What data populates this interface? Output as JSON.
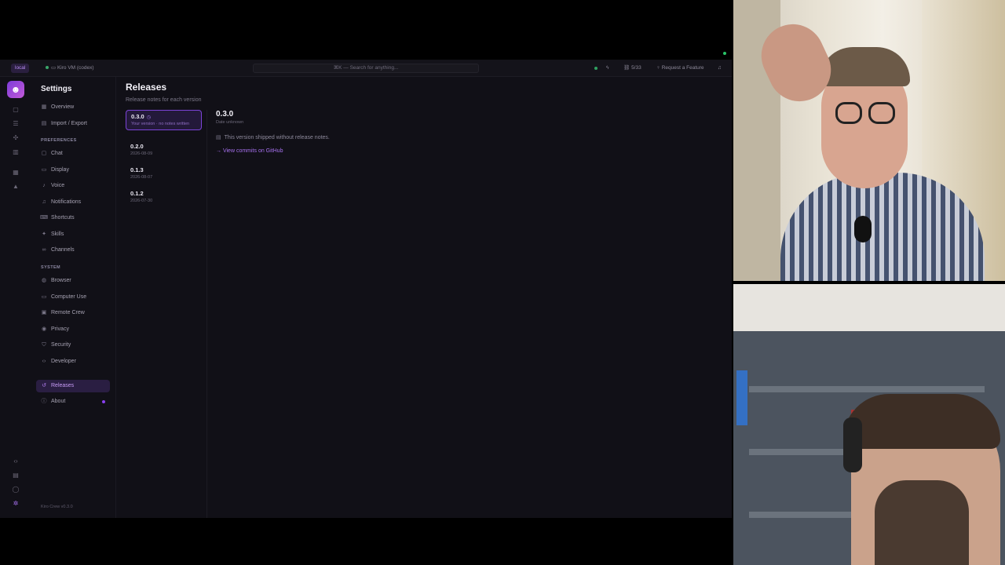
{
  "topbar": {
    "local_label": "local",
    "vm_label": "Kiro VM (codex)",
    "search_placeholder": "⌘K — Search for anything...",
    "count_label": "5/33",
    "feature_label": "Request a Feature"
  },
  "sidebar": {
    "title": "Settings",
    "top_items": [
      {
        "label": "Overview",
        "icon": "grid-icon"
      },
      {
        "label": "Import / Export",
        "icon": "import-icon"
      }
    ],
    "preferences_heading": "PREFERENCES",
    "preferences_items": [
      {
        "label": "Chat",
        "icon": "chat-icon"
      },
      {
        "label": "Display",
        "icon": "display-icon"
      },
      {
        "label": "Voice",
        "icon": "voice-icon"
      },
      {
        "label": "Notifications",
        "icon": "bell-icon"
      },
      {
        "label": "Shortcuts",
        "icon": "keyboard-icon"
      },
      {
        "label": "Skills",
        "icon": "skills-icon"
      },
      {
        "label": "Channels",
        "icon": "link-icon"
      }
    ],
    "system_heading": "SYSTEM",
    "system_items": [
      {
        "label": "Browser",
        "icon": "globe-icon"
      },
      {
        "label": "Computer Use",
        "icon": "monitor-icon"
      },
      {
        "label": "Remote Crew",
        "icon": "remote-icon"
      },
      {
        "label": "Privacy",
        "icon": "eye-icon"
      },
      {
        "label": "Security",
        "icon": "shield-icon"
      },
      {
        "label": "Developer",
        "icon": "code-icon"
      }
    ],
    "bottom_items": [
      {
        "label": "Releases",
        "icon": "history-icon",
        "active": true
      },
      {
        "label": "About",
        "icon": "info-icon",
        "badge": true
      }
    ],
    "footer": "Kiro Crew v0.3.0"
  },
  "releases": {
    "title": "Releases",
    "subtitle": "Release notes for each version",
    "versions": [
      {
        "name": "0.3.0",
        "date": "Your version · no notes written",
        "selected": true
      },
      {
        "name": "0.2.0",
        "date": "2026-08-09"
      },
      {
        "name": "0.1.3",
        "date": "2026-08-07"
      },
      {
        "name": "0.1.2",
        "date": "2026-07-30"
      }
    ],
    "detail": {
      "version": "0.3.0",
      "date": "Date unknown",
      "note": "This version shipped without release notes.",
      "link": "View commits on GitHub"
    }
  },
  "colors": {
    "accent": "#a771ef",
    "background": "#111017",
    "active_bg": "#2a1e42"
  }
}
